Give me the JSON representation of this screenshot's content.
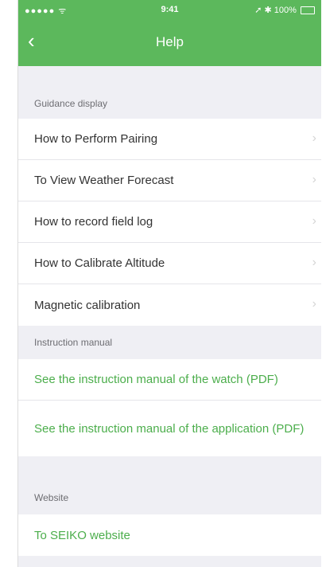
{
  "status_bar": {
    "signal": "●●●●● ᯤ",
    "time": "9:41",
    "battery": "➚ ✱ 100%"
  },
  "header": {
    "back_icon": "‹",
    "title": "Help"
  },
  "sections": {
    "guidance": {
      "label": "Guidance display",
      "items": [
        "How to Perform Pairing",
        "To View Weather Forecast",
        "How to record field log",
        "How to Calibrate Altitude",
        "Magnetic calibration"
      ]
    },
    "manual": {
      "label": "Instruction manual",
      "items": [
        "See the instruction manual of the watch (PDF)",
        "See the instruction manual of the application (PDF)"
      ]
    },
    "website": {
      "label": "Website",
      "items": [
        "To SEIKO website"
      ]
    }
  },
  "colors": {
    "accent": "#5cb85c",
    "link": "#4cae4c",
    "background": "#efeff4"
  }
}
